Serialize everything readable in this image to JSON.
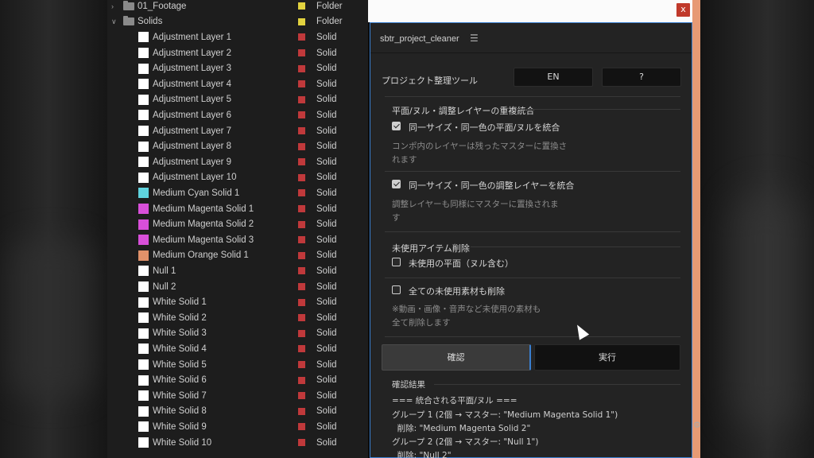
{
  "project_panel": {
    "rows": [
      {
        "name": "01_Footage",
        "kind": "folder",
        "label_color": "#e2d23f",
        "type": "Folder",
        "expanded": false
      },
      {
        "name": "Solids",
        "kind": "folder",
        "label_color": "#e2d23f",
        "type": "Folder",
        "expanded": true
      },
      {
        "name": "Adjustment Layer 1",
        "kind": "item",
        "swatch": "#ffffff",
        "label_color": "#c0393b",
        "type": "Solid"
      },
      {
        "name": "Adjustment Layer 2",
        "kind": "item",
        "swatch": "#ffffff",
        "label_color": "#c0393b",
        "type": "Solid"
      },
      {
        "name": "Adjustment Layer 3",
        "kind": "item",
        "swatch": "#ffffff",
        "label_color": "#c0393b",
        "type": "Solid"
      },
      {
        "name": "Adjustment Layer 4",
        "kind": "item",
        "swatch": "#ffffff",
        "label_color": "#c0393b",
        "type": "Solid"
      },
      {
        "name": "Adjustment Layer 5",
        "kind": "item",
        "swatch": "#ffffff",
        "label_color": "#c0393b",
        "type": "Solid"
      },
      {
        "name": "Adjustment Layer 6",
        "kind": "item",
        "swatch": "#ffffff",
        "label_color": "#c0393b",
        "type": "Solid"
      },
      {
        "name": "Adjustment Layer 7",
        "kind": "item",
        "swatch": "#ffffff",
        "label_color": "#c0393b",
        "type": "Solid"
      },
      {
        "name": "Adjustment Layer 8",
        "kind": "item",
        "swatch": "#ffffff",
        "label_color": "#c0393b",
        "type": "Solid"
      },
      {
        "name": "Adjustment Layer 9",
        "kind": "item",
        "swatch": "#ffffff",
        "label_color": "#c0393b",
        "type": "Solid"
      },
      {
        "name": "Adjustment Layer 10",
        "kind": "item",
        "swatch": "#ffffff",
        "label_color": "#c0393b",
        "type": "Solid"
      },
      {
        "name": "Medium Cyan Solid 1",
        "kind": "item",
        "swatch": "#5fd3de",
        "label_color": "#c0393b",
        "type": "Solid"
      },
      {
        "name": "Medium Magenta Solid 1",
        "kind": "item",
        "swatch": "#d84fd9",
        "label_color": "#c0393b",
        "type": "Solid"
      },
      {
        "name": "Medium Magenta Solid 2",
        "kind": "item",
        "swatch": "#d84fd9",
        "label_color": "#c0393b",
        "type": "Solid"
      },
      {
        "name": "Medium Magenta Solid 3",
        "kind": "item",
        "swatch": "#d84fd9",
        "label_color": "#c0393b",
        "type": "Solid"
      },
      {
        "name": "Medium Orange Solid 1",
        "kind": "item",
        "swatch": "#e0916a",
        "label_color": "#c0393b",
        "type": "Solid"
      },
      {
        "name": "Null 1",
        "kind": "item",
        "swatch": "#ffffff",
        "label_color": "#c0393b",
        "type": "Solid"
      },
      {
        "name": "Null 2",
        "kind": "item",
        "swatch": "#ffffff",
        "label_color": "#c0393b",
        "type": "Solid"
      },
      {
        "name": "White Solid 1",
        "kind": "item",
        "swatch": "#ffffff",
        "label_color": "#c0393b",
        "type": "Solid"
      },
      {
        "name": "White Solid 2",
        "kind": "item",
        "swatch": "#ffffff",
        "label_color": "#c0393b",
        "type": "Solid"
      },
      {
        "name": "White Solid 3",
        "kind": "item",
        "swatch": "#ffffff",
        "label_color": "#c0393b",
        "type": "Solid"
      },
      {
        "name": "White Solid 4",
        "kind": "item",
        "swatch": "#ffffff",
        "label_color": "#c0393b",
        "type": "Solid"
      },
      {
        "name": "White Solid 5",
        "kind": "item",
        "swatch": "#ffffff",
        "label_color": "#c0393b",
        "type": "Solid"
      },
      {
        "name": "White Solid 6",
        "kind": "item",
        "swatch": "#ffffff",
        "label_color": "#c0393b",
        "type": "Solid"
      },
      {
        "name": "White Solid 7",
        "kind": "item",
        "swatch": "#ffffff",
        "label_color": "#c0393b",
        "type": "Solid"
      },
      {
        "name": "White Solid 8",
        "kind": "item",
        "swatch": "#ffffff",
        "label_color": "#c0393b",
        "type": "Solid"
      },
      {
        "name": "White Solid 9",
        "kind": "item",
        "swatch": "#ffffff",
        "label_color": "#c0393b",
        "type": "Solid"
      },
      {
        "name": "White Solid 10",
        "kind": "item",
        "swatch": "#ffffff",
        "label_color": "#c0393b",
        "type": "Solid"
      }
    ]
  },
  "window": {
    "close_label": "x",
    "close_color": "#c0392b",
    "accent": "#3a7fd0"
  },
  "plugin": {
    "title": "sbtr_project_cleaner",
    "menu_icon": "hamburger-icon",
    "tool_label": "プロジェクト整理ツール",
    "lang_button": "EN",
    "help_button": "?",
    "section_merge": {
      "heading": "平面/ヌル・調整レイヤーの重複統合",
      "option1": {
        "label": "同一サイズ・同一色の平面/ヌルを統合",
        "checked": true,
        "note_line1": "コンポ内のレイヤーは残ったマスターに置換さ",
        "note_line2": "れます"
      },
      "option2": {
        "label": "同一サイズ・同一色の調整レイヤーを統合",
        "checked": true,
        "note_line1": "調整レイヤーも同様にマスターに置換されま",
        "note_line2": "す"
      }
    },
    "section_delete": {
      "heading": "未使用アイテム削除",
      "option1": {
        "label": "未使用の平面（ヌル含む）",
        "checked": false
      },
      "option2": {
        "label": "全ての未使用素材も削除",
        "checked": false,
        "note_line1": "※動画・画像・音声など未使用の素材も",
        "note_line2": "全て削除します"
      }
    },
    "confirm_button": "確認",
    "run_button": "実行",
    "results": {
      "heading": "確認結果",
      "lines": [
        "=== 統合される平面/ヌル ===",
        "グループ 1 (2個 → マスター: \"Medium Magenta Solid 1\")",
        "  削除: \"Medium Magenta Solid 2\"",
        "グループ 2 (2個 → マスター: \"Null 1\")",
        "  削除: \"Null 2\""
      ]
    }
  }
}
